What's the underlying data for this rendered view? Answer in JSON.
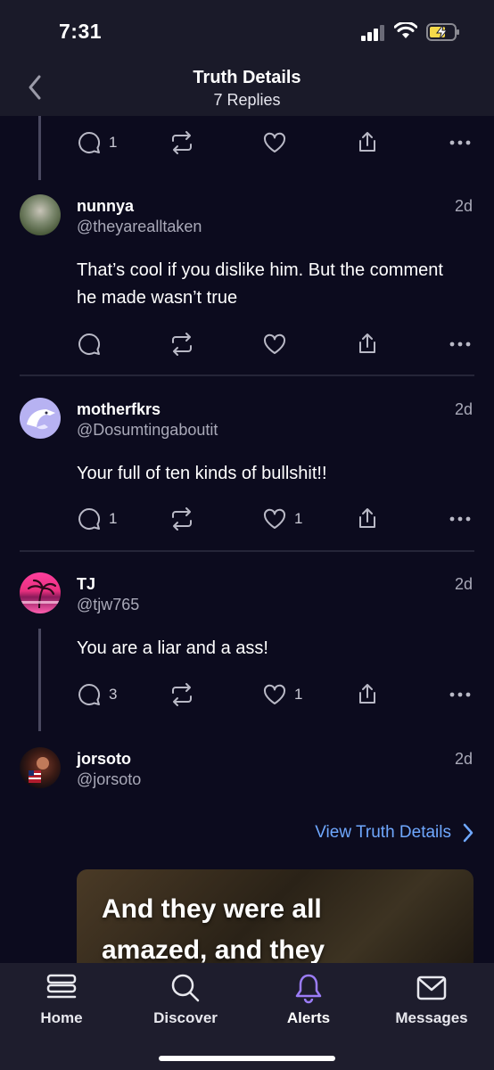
{
  "status_bar": {
    "time": "7:31"
  },
  "header": {
    "title": "Truth Details",
    "subtitle": "7 Replies"
  },
  "top_actions": {
    "reply_count": "1",
    "like_count": "",
    "retruth_count": ""
  },
  "posts": [
    {
      "name": "nunnya",
      "handle": "@theyarealltaken",
      "time": "2d",
      "text": "That’s cool if you dislike him. But the comment he made wasn’t true",
      "reply_count": "",
      "like_count": ""
    },
    {
      "name": "motherfkrs",
      "handle": "@Dosumtingaboutit",
      "time": "2d",
      "text": "Your full of ten kinds of bullshit!!",
      "reply_count": "1",
      "like_count": "1"
    },
    {
      "name": "TJ",
      "handle": "@tjw765",
      "time": "2d",
      "text": "You are a liar and a ass!",
      "reply_count": "3",
      "like_count": "1"
    },
    {
      "name": "jorsoto",
      "handle": "@jorsoto",
      "time": "2d",
      "text": ""
    }
  ],
  "view_details_label": "View Truth Details",
  "media": {
    "caption": "And they were all amazed, and they"
  },
  "tabbar": {
    "items": [
      {
        "label": "Home",
        "icon": "home-icon"
      },
      {
        "label": "Discover",
        "icon": "search-icon"
      },
      {
        "label": "Alerts",
        "icon": "bell-icon"
      },
      {
        "label": "Messages",
        "icon": "mail-icon"
      }
    ],
    "active": "Alerts"
  },
  "colors": {
    "background": "#0c0b1e",
    "bar": "#1a1a29",
    "accent_link": "#6fa8ff",
    "active_tab": "#9b7cf6"
  }
}
